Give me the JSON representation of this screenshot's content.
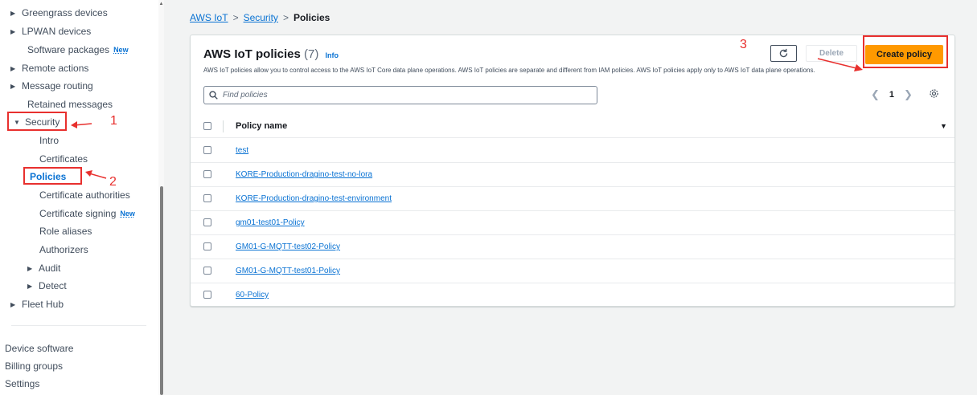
{
  "sidebar": {
    "items": [
      {
        "label": "Greengrass devices",
        "expander": "right"
      },
      {
        "label": "LPWAN devices",
        "expander": "right"
      },
      {
        "label": "Software packages",
        "badge": "New"
      },
      {
        "label": "Remote actions",
        "expander": "right"
      },
      {
        "label": "Message routing",
        "expander": "right"
      },
      {
        "label": "Retained messages"
      },
      {
        "label": "Security",
        "expander": "down"
      },
      {
        "label": "Intro"
      },
      {
        "label": "Certificates"
      },
      {
        "label": "Policies",
        "active": true
      },
      {
        "label": "Certificate authorities"
      },
      {
        "label": "Certificate signing",
        "badge": "New"
      },
      {
        "label": "Role aliases"
      },
      {
        "label": "Authorizers"
      },
      {
        "label": "Audit",
        "expander": "right"
      },
      {
        "label": "Detect",
        "expander": "right"
      },
      {
        "label": "Fleet Hub",
        "expander": "right"
      },
      {
        "label": "Device software"
      },
      {
        "label": "Billing groups"
      },
      {
        "label": "Settings"
      }
    ]
  },
  "annotations": {
    "step1": "1",
    "step2": "2",
    "step3": "3",
    "color": "#e8302e"
  },
  "breadcrumb": {
    "root": "AWS IoT",
    "middle": "Security",
    "current": "Policies",
    "separator": ">"
  },
  "card": {
    "title": "AWS IoT policies",
    "count": "(7)",
    "info": "Info",
    "description": "AWS IoT policies allow you to control access to the AWS IoT Core data plane operations. AWS IoT policies are separate and different from IAM policies. AWS IoT policies apply only to AWS IoT data plane operations.",
    "delete_label": "Delete",
    "create_label": "Create policy",
    "search_placeholder": "Find policies",
    "page_number": "1",
    "column_header": "Policy name",
    "policies": [
      "test",
      "KORE-Production-dragino-test-no-lora",
      "KORE-Production-dragino-test-environment",
      "gm01-test01-Policy",
      "GM01-G-MQTT-test02-Policy",
      "GM01-G-MQTT-test01-Policy",
      "60-Policy"
    ]
  },
  "colors": {
    "accent": "#0972d3",
    "primary_button": "#ff9900",
    "background": "#f2f3f3"
  }
}
